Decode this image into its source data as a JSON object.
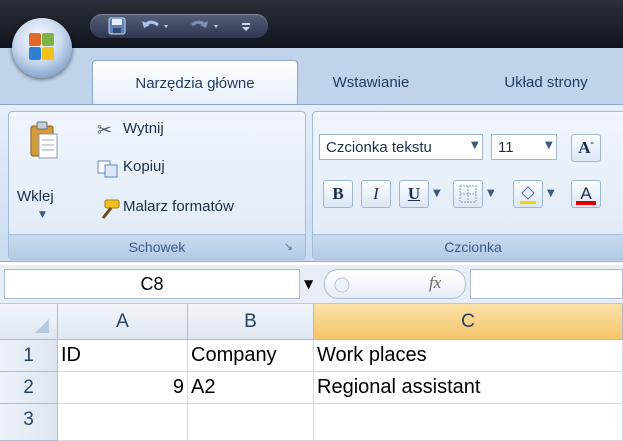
{
  "quick_access": {
    "save_icon": "save-icon",
    "undo_icon": "undo-icon",
    "redo_icon": "redo-icon",
    "customize_icon": "customize-qat-icon"
  },
  "tabs": [
    {
      "label": "Narzędzia główne",
      "active": true
    },
    {
      "label": "Wstawianie",
      "active": false
    },
    {
      "label": "Układ strony",
      "active": false
    }
  ],
  "clipboard_group": {
    "paste_label": "Wklej",
    "cut_label": "Wytnij",
    "copy_label": "Kopiuj",
    "format_painter_label": "Malarz formatów",
    "group_label": "Schowek"
  },
  "font_group": {
    "font_name": "Czcionka tekstu",
    "font_size": "11",
    "grow_font_label": "A",
    "bold_label": "B",
    "italic_label": "I",
    "underline_label": "U",
    "font_color_label": "A",
    "group_label": "Czcionka"
  },
  "formula_bar": {
    "name_box": "C8",
    "fx_label": "fx",
    "formula": ""
  },
  "sheet": {
    "columns": [
      "A",
      "B",
      "C"
    ],
    "selected_column": "C",
    "rows": [
      {
        "num": "1",
        "cells": [
          "ID",
          "Company",
          "Work places"
        ]
      },
      {
        "num": "2",
        "cells": [
          "9",
          "A2",
          "Regional assistant"
        ]
      },
      {
        "num": "3",
        "cells": [
          "",
          "",
          ""
        ]
      }
    ]
  },
  "colors": {
    "accent_selected_header": "#f6c46a",
    "ribbon_bg": "#d6e4f5",
    "font_color_bar": "#e00000"
  }
}
